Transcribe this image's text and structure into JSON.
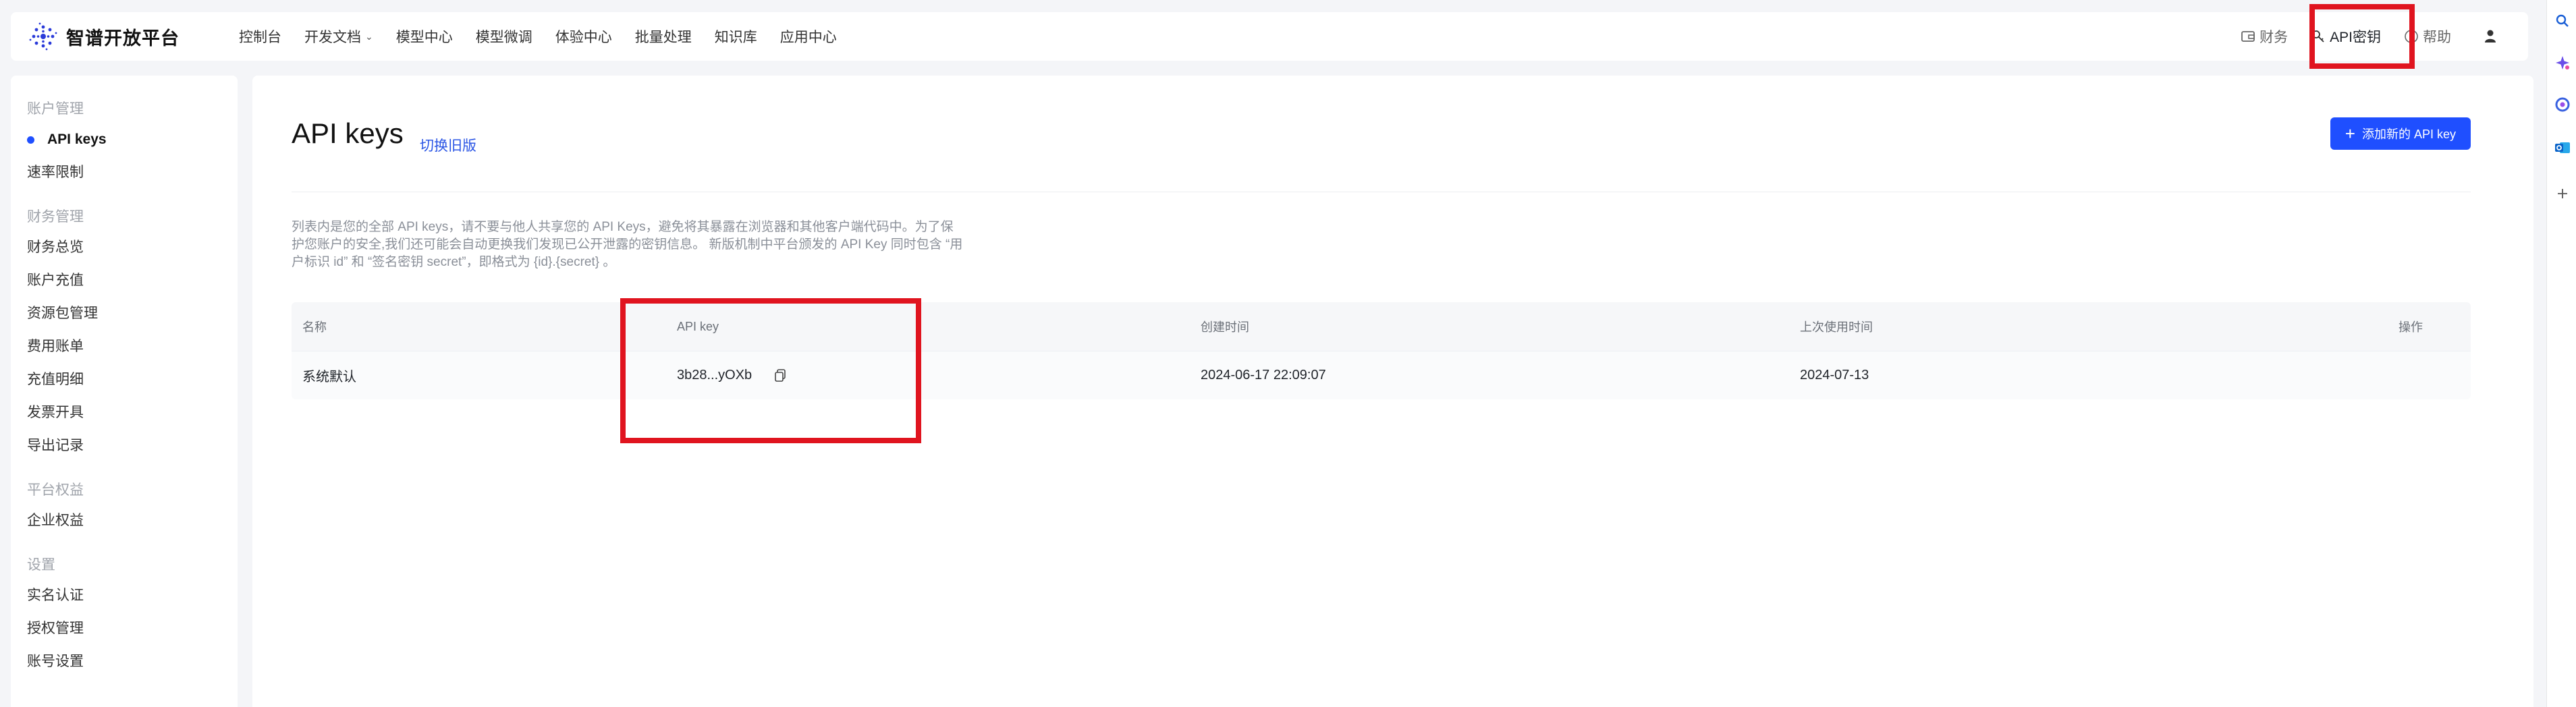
{
  "brand": {
    "name": "智谱开放平台"
  },
  "nav": [
    "控制台",
    "开发文档",
    "模型中心",
    "模型微调",
    "体验中心",
    "批量处理",
    "知识库",
    "应用中心"
  ],
  "header_right": {
    "finance": "财务",
    "api_key": "API密钥",
    "help": "帮助"
  },
  "sidebar": {
    "groups": [
      {
        "title": "账户管理",
        "items": [
          "API keys",
          "速率限制"
        ]
      },
      {
        "title": "财务管理",
        "items": [
          "财务总览",
          "账户充值",
          "资源包管理",
          "费用账单",
          "充值明细",
          "发票开具",
          "导出记录"
        ]
      },
      {
        "title": "平台权益",
        "items": [
          "企业权益"
        ]
      },
      {
        "title": "设置",
        "items": [
          "实名认证",
          "授权管理",
          "账号设置"
        ]
      }
    ],
    "active": "API keys"
  },
  "main": {
    "title": "API keys",
    "switch_old": "切换旧版",
    "add_button": "添加新的 API key",
    "description_lines": [
      "列表内是您的全部 API keys，请不要与他人共享您的 API Keys，避免将其暴露在浏览器和其他客户端代码中。为了保",
      "护您账户的安全,我们还可能会自动更换我们发现已公开泄露的密钥信息。 新版机制中平台颁发的 API Key 同时包含 “用",
      "户标识 id” 和 “签名密钥 secret”，即格式为 {id}.{secret} 。"
    ],
    "table": {
      "headers": [
        "名称",
        "API key",
        "创建时间",
        "上次使用时间",
        "操作"
      ],
      "rows": [
        {
          "name": "系统默认",
          "api_key": "3b28...yOXb",
          "created": "2024-06-17 22:09:07",
          "last_used": "2024-07-13",
          "action": ""
        }
      ]
    }
  },
  "colors": {
    "accent": "#1f4fff",
    "link": "#2a55e5",
    "highlight": "#e0141f"
  }
}
